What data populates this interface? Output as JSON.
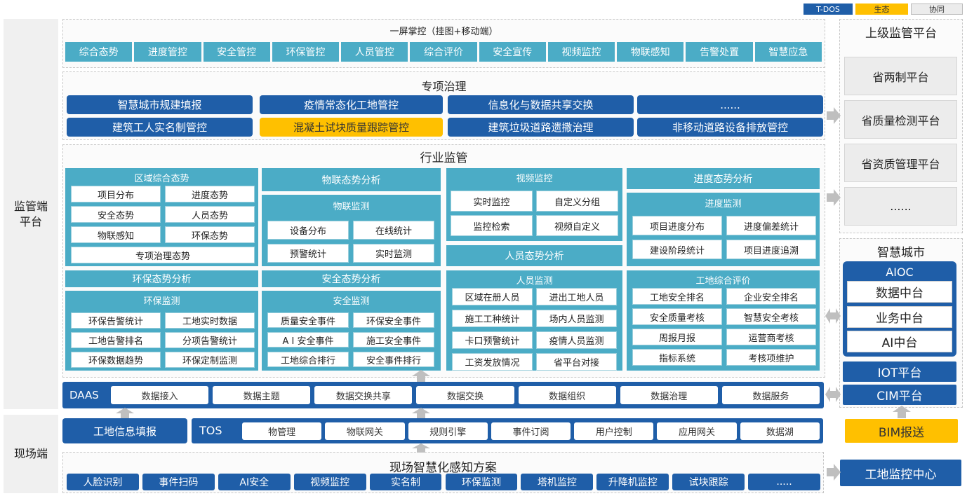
{
  "legend": {
    "tdos": "T-DOS",
    "eco": "生态",
    "coop": "协同"
  },
  "side": {
    "regulator": "监管端\n平台",
    "site": "现场端"
  },
  "screen": {
    "title": "一屏掌控（挂图+移动端）",
    "items": [
      "综合态势",
      "进度管控",
      "安全管控",
      "环保管控",
      "人员管控",
      "综合评价",
      "安全宣传",
      "视频监控",
      "物联感知",
      "告警处置",
      "智慧应急"
    ]
  },
  "special": {
    "title": "专项治理",
    "row1": [
      "智慧城市规建填报",
      "疫情常态化工地管控",
      "信息化与数据共享交换",
      "......"
    ],
    "row2": [
      "建筑工人实名制管控",
      "混凝土试块质量跟踪管控",
      "建筑垃圾道路遗撒治理",
      "非移动道路设备排放管控"
    ]
  },
  "industry": {
    "title": "行业监管",
    "region": {
      "title": "区域综合态势",
      "items": [
        "项目分布",
        "进度态势",
        "安全态势",
        "人员态势",
        "物联感知",
        "环保态势"
      ],
      "wide": "专项治理态势"
    },
    "env_analysis": "环保态势分析",
    "env": {
      "title": "环保监测",
      "items": [
        "环保告警统计",
        "工地实时数据",
        "工地告警排名",
        "分项告警统计",
        "环保数据趋势",
        "环保定制监测"
      ]
    },
    "iot_analysis": "物联态势分析",
    "iot": {
      "title": "物联监测",
      "items": [
        "设备分布",
        "在线统计",
        "预警统计",
        "实时监测"
      ]
    },
    "safety_analysis": "安全态势分析",
    "safety": {
      "title": "安全监测",
      "items": [
        "质量安全事件",
        "环保安全事件",
        "A I 安全事件",
        "施工安全事件",
        "工地综合排行",
        "安全事件排行"
      ]
    },
    "video": {
      "title": "视频监控",
      "items": [
        "实时监控",
        "自定义分组",
        "监控检索",
        "视频自定义"
      ]
    },
    "person_analysis": "人员态势分析",
    "person": {
      "title": "人员监测",
      "items": [
        "区域在册人员",
        "进出工地人员",
        "施工工种统计",
        "场内人员监测",
        "卡口预警统计",
        "疫情人员监测",
        "工资发放情况",
        "省平台对接"
      ]
    },
    "progress_analysis": "进度态势分析",
    "progress": {
      "title": "进度监测",
      "items": [
        "项目进度分布",
        "进度偏差统计",
        "建设阶段统计",
        "项目进度追溯"
      ]
    },
    "eval": {
      "title": "工地综合评价",
      "items": [
        "工地安全排名",
        "企业安全排名",
        "安全质量考核",
        "智慧安全考核",
        "周报月报",
        "运营商考核",
        "指标系统",
        "考核项维护"
      ]
    }
  },
  "daas": {
    "label": "DAAS",
    "items": [
      "数据接入",
      "数据主题",
      "数据交换共享",
      "数据交换",
      "数据组织",
      "数据治理",
      "数据服务"
    ]
  },
  "tos": {
    "fill": "工地信息填报",
    "label": "TOS",
    "items": [
      "物管理",
      "物联网关",
      "规则引擎",
      "事件订阅",
      "用户控制",
      "应用网关",
      "数据湖"
    ]
  },
  "sense": {
    "title": "现场智慧化感知方案",
    "items": [
      "人脸识别",
      "事件扫码",
      "AI安全",
      "视频监控",
      "实名制",
      "环保监测",
      "塔机监控",
      "升降机监控",
      "试块跟踪",
      "....."
    ]
  },
  "upper": {
    "title": "上级监管平台",
    "items": [
      "省两制平台",
      "省质量检测平台",
      "省资质管理平台",
      "......"
    ]
  },
  "city": {
    "title": "智慧城市",
    "aioc": "AIOC",
    "items": [
      "数据中台",
      "业务中台",
      "AI中台"
    ],
    "iot": "IOT平台",
    "cim": "CIM平台"
  },
  "bim": "BIM报送",
  "site_center": "工地监控中心",
  "colors": {
    "teal": "#4bacc6",
    "navy": "#1f5ea8",
    "gold": "#ffc000",
    "grey": "#ececec"
  }
}
